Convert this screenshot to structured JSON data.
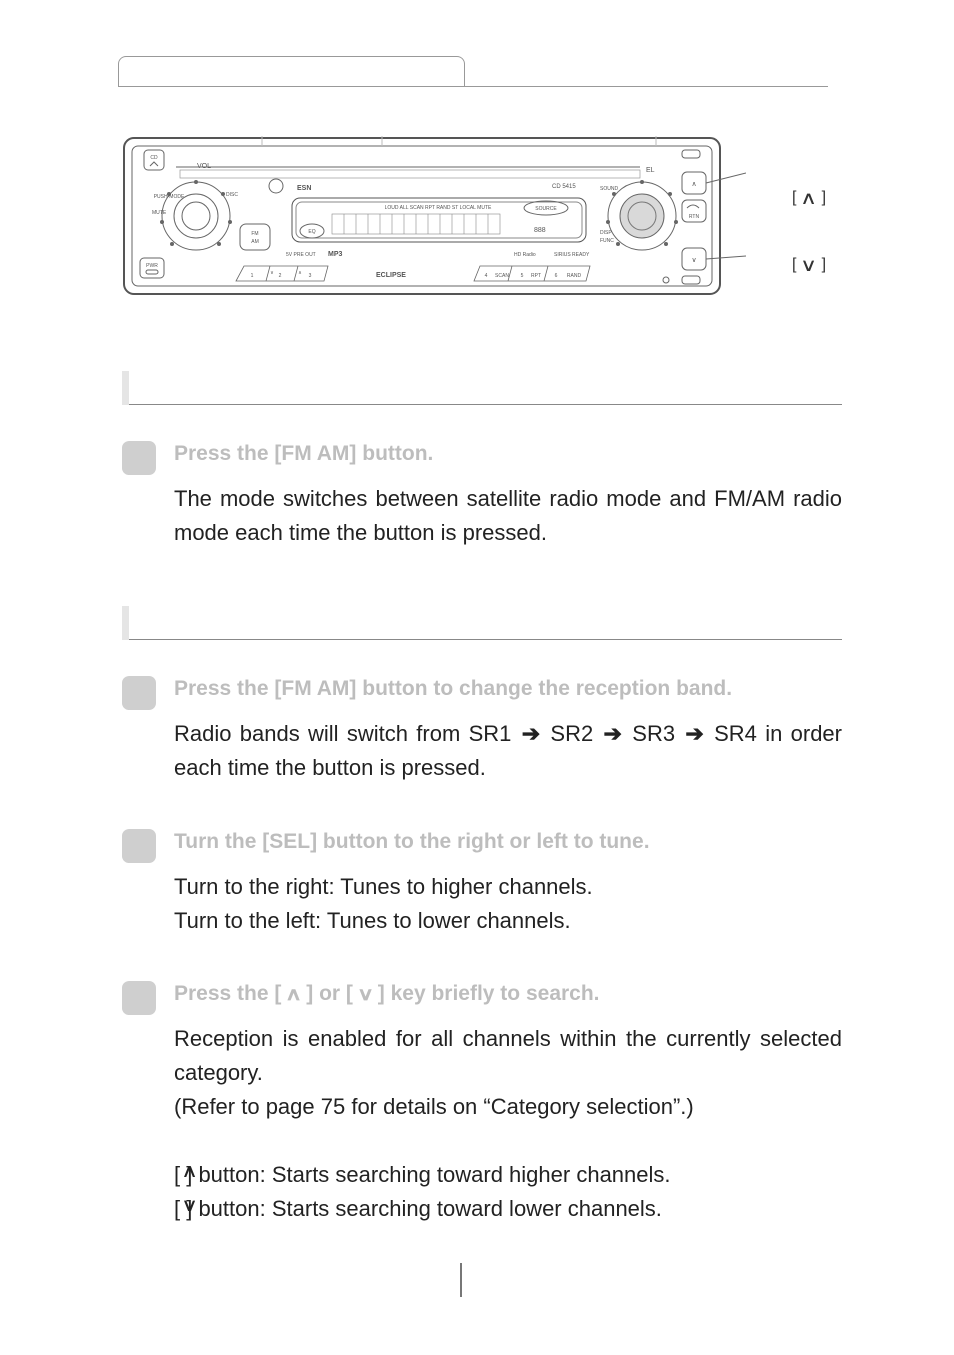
{
  "device": {
    "brand": "ESN",
    "model": "CD 5415",
    "eclipse": "ECLIPSE",
    "preout": "5V PRE OUT",
    "mp3": "MP3",
    "hd": "HD Radio",
    "sirius": "SIRIUS READY",
    "btn_cd": "CD",
    "btn_vol": "VOL",
    "btn_disc": "DISC",
    "btn_mute": "MUTE",
    "btn_push_mode": "PUSH-MODE",
    "btn_fm_am": "FM AM",
    "btn_pwr": "PWR",
    "btn_eq": "EQ",
    "btn_el": "EL",
    "btn_sound": "SOUND",
    "btn_disp": "DISP",
    "btn_func": "FUNC",
    "btn_rtn": "RTN",
    "btn_source": "SOURCE",
    "lcd_row": "LOUD  ALL SCAN RPT RAND  ST LOCAL MUTE",
    "num_1": "1",
    "num_2": "2",
    "num_3": "3",
    "num_4": "4",
    "num_5": "5",
    "num_6": "6",
    "num_4_label": "SCAN",
    "num_5_label": "RPT",
    "num_6_label": "RAND",
    "num_2_up": "∨",
    "num_3_up": "∧",
    "side_up": "[    ] button",
    "side_down": "[    ] button",
    "btn_up": "∧",
    "btn_down": "∨"
  },
  "section1": {
    "step1": {
      "title": "Press the [FM AM] button.",
      "body": "The mode switches between satellite radio mode and FM/AM radio mode each time the button is pressed."
    }
  },
  "section2": {
    "step1": {
      "title": "Press the [FM AM] button to change the reception band.",
      "body_pre": "Radio bands will switch from SR1 ",
      "body_s2": " SR2 ",
      "body_s3": " SR3 ",
      "body_s4": " SR4 in order each time the button is pressed."
    },
    "step2": {
      "title": "Turn the [SEL] button to the right or left to tune.",
      "line1": "Turn to the right: Tunes to higher channels.",
      "line2": "Turn to the left:   Tunes to lower channels."
    },
    "step3": {
      "title_pre": "Press the [ ",
      "title_mid": " ] or [ ",
      "title_post": " ] key briefly to search.",
      "p1": "Reception is enabled for all channels within the currently selected category.",
      "p2": "(Refer to page 75 for details on “Category selection”.)",
      "l_up": "[     ] button: Starts searching toward higher channels.",
      "l_dn": "[     ] button: Starts searching toward lower channels.",
      "glyph_up": "∧",
      "glyph_dn": "∨"
    }
  }
}
